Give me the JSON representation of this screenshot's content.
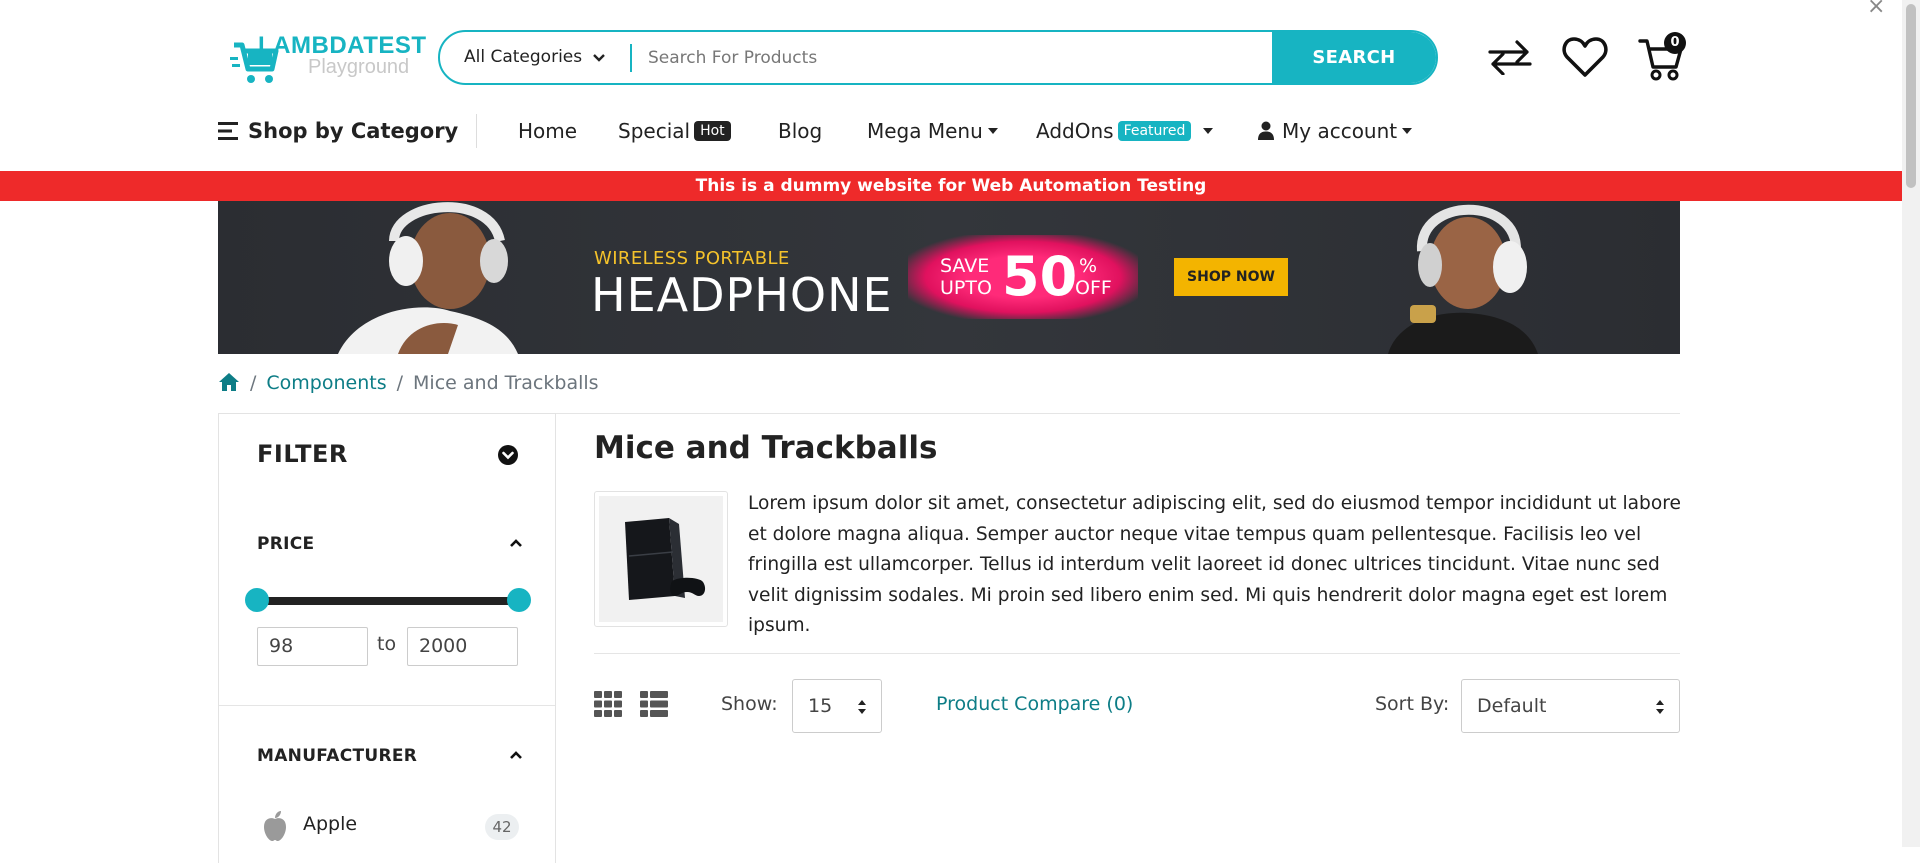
{
  "colors": {
    "accent": "#17b4c2",
    "alert_strip": "#ee2a2a",
    "hot_badge": "#222222",
    "featured_badge": "#17b4c2",
    "shop_button": "#f3b400",
    "deal_pink": "#ff2a79"
  },
  "logo": {
    "word": "LAMBDATEST",
    "sub": "Playground"
  },
  "search": {
    "category": "All Categories",
    "placeholder": "Search For Products",
    "value": "",
    "button": "SEARCH"
  },
  "header_icons": {
    "compare": "compare-arrows-icon",
    "wishlist": "heart-icon",
    "cart": "cart-icon",
    "cart_count": "0",
    "close": "×"
  },
  "nav": {
    "shop_by_category": "Shop by Category",
    "home": "Home",
    "special": "Special",
    "special_badge": "Hot",
    "blog": "Blog",
    "mega_menu": "Mega Menu",
    "addons": "AddOns",
    "addons_badge": "Featured",
    "my_account": "My account"
  },
  "notice": "This is a dummy website for Web Automation Testing",
  "banner": {
    "subtitle": "WIRELESS PORTABLE",
    "title": "HEADPHONE",
    "save_line1": "SAVE",
    "save_line2": "UPTO",
    "discount": "50",
    "pct": "%",
    "off": "OFF",
    "cta": "SHOP NOW"
  },
  "breadcrumb": {
    "home_icon": "home-icon",
    "items": [
      "Components",
      "Mice and Trackballs"
    ],
    "separator": "/"
  },
  "filter": {
    "title": "FILTER",
    "price": {
      "title": "PRICE",
      "min": "98",
      "max": "2000",
      "to": "to",
      "range_min": 98,
      "range_max": 2000
    },
    "manufacturer": {
      "title": "MANUFACTURER",
      "items": [
        {
          "name": "Apple",
          "count": "42"
        }
      ]
    }
  },
  "category": {
    "title": "Mice and Trackballs",
    "description": "Lorem ipsum dolor sit amet, consectetur adipiscing elit, sed do eiusmod tempor incididunt ut labore et dolore magna aliqua. Semper auctor neque vitae tempus quam pellentesque. Facilisis leo vel fringilla est ullamcorper. Tellus id interdum velit laoreet id donec ultrices tincidunt. Vitae nunc sed velit dignissim sodales. Mi proin sed libero enim sed. Mi quis hendrerit dolor magna eget est lorem ipsum."
  },
  "toolbar": {
    "show_label": "Show:",
    "show_value": "15",
    "compare": "Product Compare (0)",
    "sort_label": "Sort By:",
    "sort_value": "Default"
  }
}
